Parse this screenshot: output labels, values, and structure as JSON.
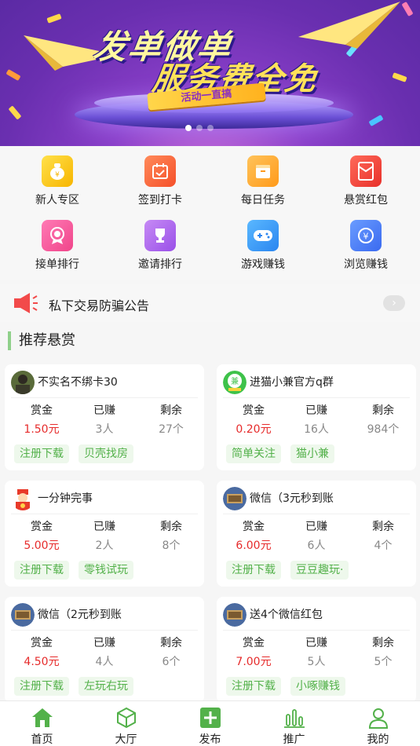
{
  "banner": {
    "title_line1": "发单做单",
    "title_line2": "服务费全免",
    "tag": "活动一直搞",
    "active_dot": 0,
    "dot_count": 3
  },
  "quick_grid": [
    {
      "label": "新人专区",
      "icon": "money-bag-icon",
      "color": "#f7c600"
    },
    {
      "label": "签到打卡",
      "icon": "calendar-check-icon",
      "color": "#ff6a3a"
    },
    {
      "label": "每日任务",
      "icon": "task-box-icon",
      "color": "#ffa52a"
    },
    {
      "label": "悬赏红包",
      "icon": "red-envelope-icon",
      "color": "#f5483a"
    },
    {
      "label": "接单排行",
      "icon": "medal-icon",
      "color": "#f45a9e"
    },
    {
      "label": "邀请排行",
      "icon": "trophy-icon",
      "color": "#b060f0"
    },
    {
      "label": "游戏赚钱",
      "icon": "gamepad-icon",
      "color": "#3a9cff"
    },
    {
      "label": "浏览赚钱",
      "icon": "yuan-coin-icon",
      "color": "#3f7cf5"
    }
  ],
  "notice": {
    "text": "私下交易防骗公告",
    "icon": "megaphone-icon",
    "icon_color": "#f24a4a"
  },
  "section_title": "推荐悬赏",
  "stat_headers": {
    "reward": "赏金",
    "earned": "已赚",
    "remaining": "剩余"
  },
  "cards": [
    {
      "title": "不实名不绑卡30",
      "avatar": "photo-avatar",
      "reward": "1.50元",
      "earned": "3人",
      "remaining": "27个",
      "tags": [
        "注册下载",
        "贝壳找房"
      ]
    },
    {
      "title": "进猫小兼官方q群",
      "avatar": "jian-logo-avatar",
      "reward": "0.20元",
      "earned": "16人",
      "remaining": "984个",
      "tags": [
        "简单关注",
        "猫小兼"
      ]
    },
    {
      "title": "一分钟完事",
      "avatar": "god-of-wealth-avatar",
      "reward": "5.00元",
      "earned": "2人",
      "remaining": "8个",
      "tags": [
        "注册下载",
        "零钱试玩"
      ]
    },
    {
      "title": "微信（3元秒到账",
      "avatar": "screen-avatar",
      "reward": "6.00元",
      "earned": "6人",
      "remaining": "4个",
      "tags": [
        "注册下载",
        "豆豆趣玩·"
      ]
    },
    {
      "title": "微信（2元秒到账",
      "avatar": "screen-avatar",
      "reward": "4.50元",
      "earned": "4人",
      "remaining": "6个",
      "tags": [
        "注册下载",
        "左玩右玩"
      ]
    },
    {
      "title": "送4个微信红包",
      "avatar": "screen-avatar",
      "reward": "7.00元",
      "earned": "5人",
      "remaining": "5个",
      "tags": [
        "注册下载",
        "小啄赚钱"
      ]
    }
  ],
  "tabbar": [
    {
      "label": "首页",
      "icon": "home-icon",
      "active": true
    },
    {
      "label": "大厅",
      "icon": "cube-icon",
      "active": false
    },
    {
      "label": "发布",
      "icon": "plus-square-icon",
      "active": false
    },
    {
      "label": "推广",
      "icon": "bar-chart-icon",
      "active": false
    },
    {
      "label": "我的",
      "icon": "user-icon",
      "active": false
    }
  ],
  "colors": {
    "accent_green": "#53b14a",
    "reward_red": "#e62b2b",
    "tag_bg": "#eef8ec"
  }
}
